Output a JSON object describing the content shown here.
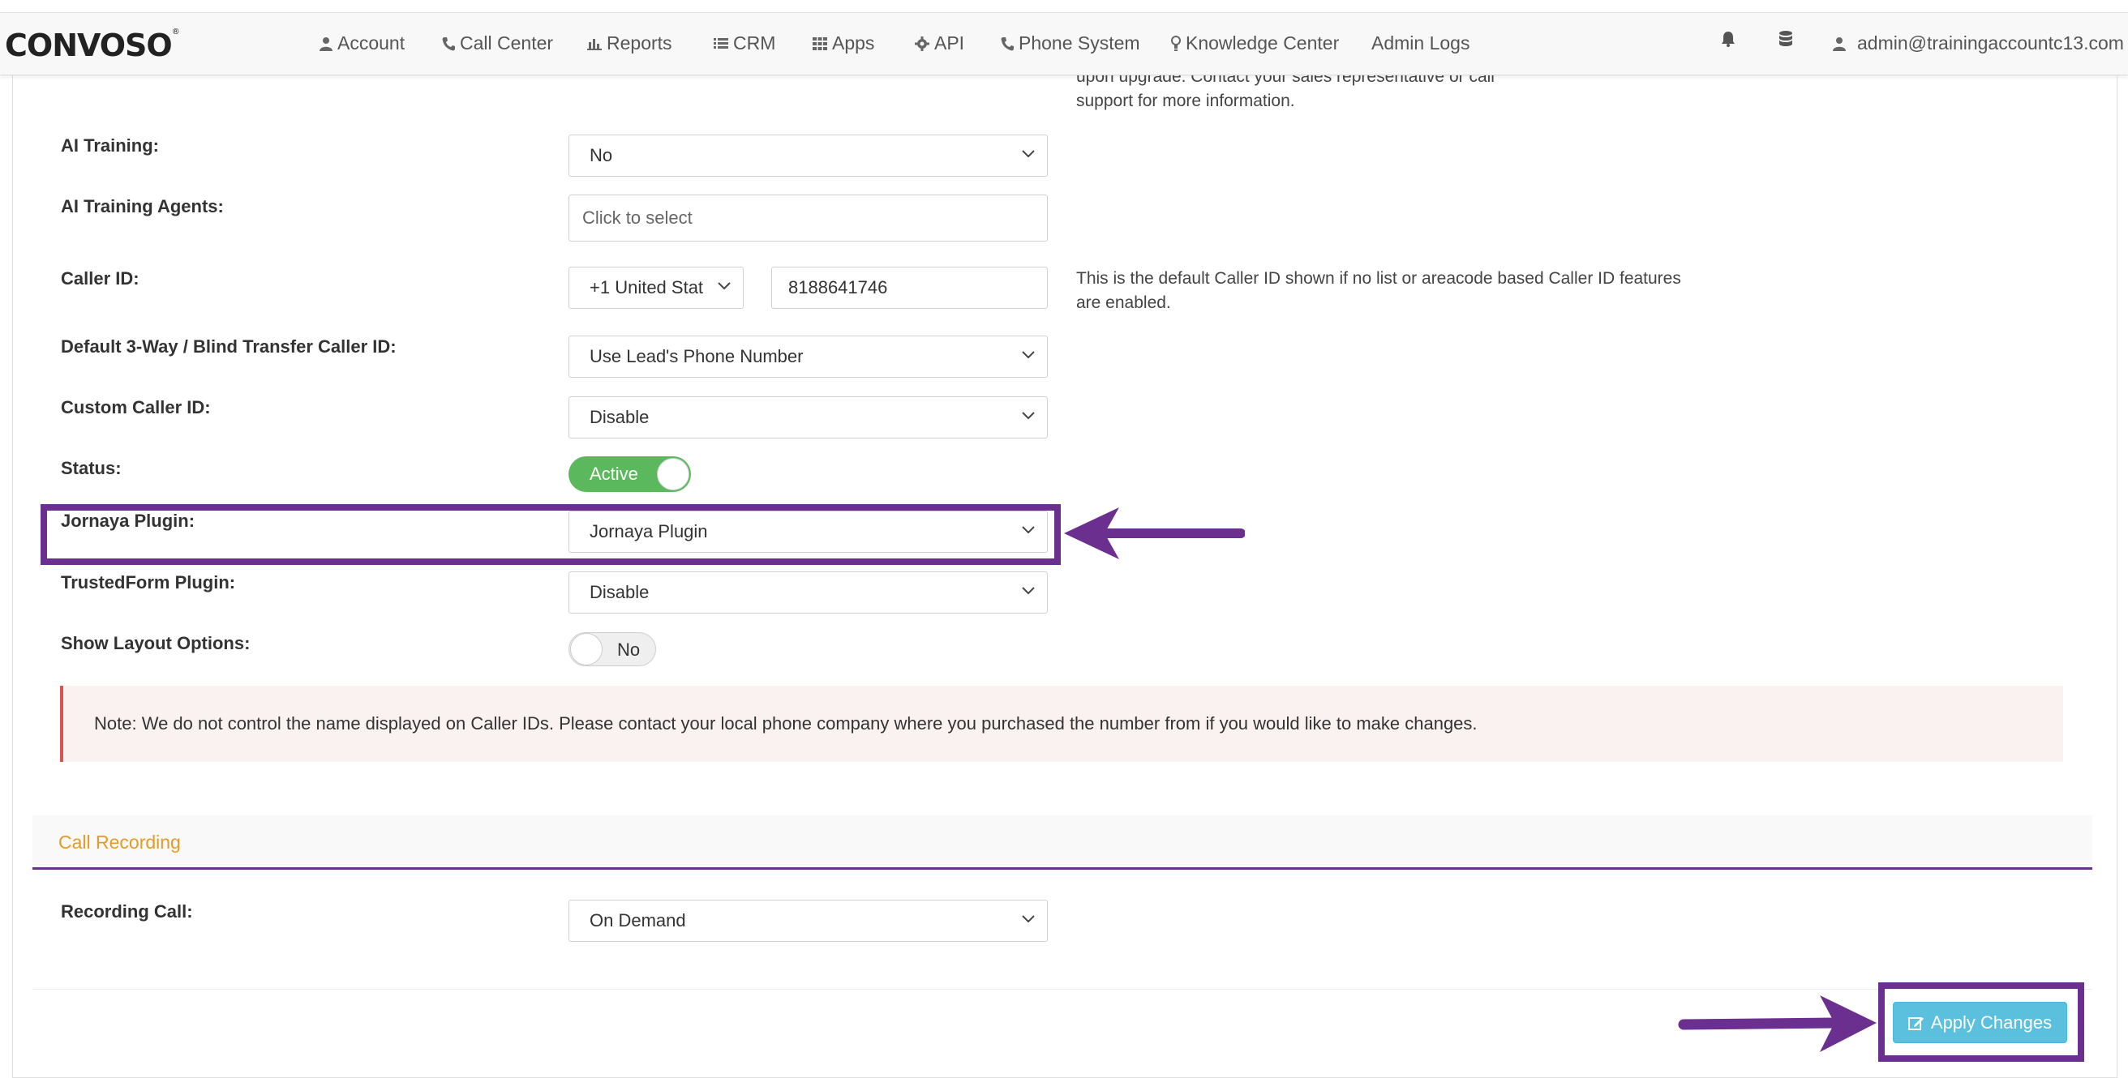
{
  "brand": {
    "logo_text": "CONVOSO"
  },
  "nav": {
    "items": [
      {
        "label": "Account",
        "icon": "user-icon"
      },
      {
        "label": "Call Center",
        "icon": "phone-icon"
      },
      {
        "label": "Reports",
        "icon": "bar-chart-icon"
      },
      {
        "label": "CRM",
        "icon": "list-icon"
      },
      {
        "label": "Apps",
        "icon": "grid-icon"
      },
      {
        "label": "API",
        "icon": "gear-icon"
      },
      {
        "label": "Phone System",
        "icon": "phone-icon"
      },
      {
        "label": "Knowledge Center",
        "icon": "lightbulb-icon"
      },
      {
        "label": "Admin Logs",
        "icon": ""
      }
    ],
    "user_email": "admin@trainingaccountc13.com"
  },
  "upgrade_note": {
    "line1": "upon upgrade. Contact your sales representative or call",
    "line2": "support for more information."
  },
  "form": {
    "ai_training": {
      "label": "AI Training:",
      "value": "No"
    },
    "ai_training_agents": {
      "label": "AI Training Agents:",
      "placeholder": "Click to select"
    },
    "caller_id": {
      "label": "Caller ID:",
      "country": "+1 United Stat",
      "number": "8188641746",
      "help_line1": "This is the default Caller ID shown if no list or areacode based Caller ID features",
      "help_line2": "are enabled."
    },
    "transfer_caller_id": {
      "label": "Default 3-Way / Blind Transfer Caller ID:",
      "value": "Use Lead's Phone Number"
    },
    "custom_caller_id": {
      "label": "Custom Caller ID:",
      "value": "Disable"
    },
    "status": {
      "label": "Status:",
      "value": "Active"
    },
    "jornaya_plugin": {
      "label": "Jornaya Plugin:",
      "value": "Jornaya Plugin"
    },
    "trustedform_plugin": {
      "label": "TrustedForm Plugin:",
      "value": "Disable"
    },
    "show_layout_options": {
      "label": "Show Layout Options:",
      "value": "No"
    }
  },
  "note": "Note: We do not control the name displayed on Caller IDs. Please contact your local phone company where you purchased the number from if you would like to make changes.",
  "call_recording": {
    "section_title": "Call Recording",
    "recording_call": {
      "label": "Recording Call:",
      "value": "On Demand"
    }
  },
  "actions": {
    "apply_label": "Apply Changes"
  },
  "colors": {
    "annotation": "#6b2f8f",
    "toggle_on": "#5cb85c",
    "apply_button": "#5bc0de",
    "section_title": "#e69a28",
    "note_border": "#d9534f"
  }
}
